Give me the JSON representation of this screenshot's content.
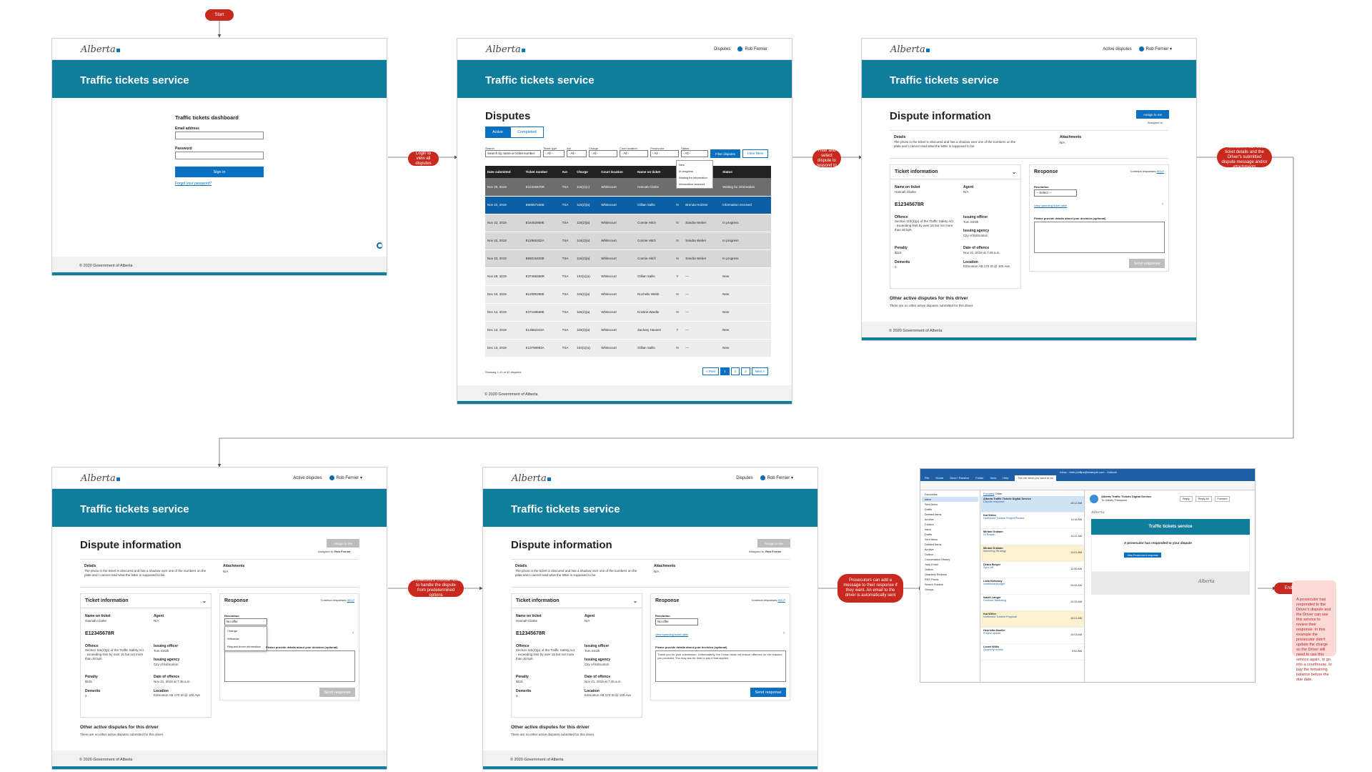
{
  "flow": {
    "start_label": "Start",
    "end_label": "End",
    "end_note": "A prosecutor has responded to the Driver's dispute and the Driver can use this service to review their response. In this example the prosecutor didn't update the charge so the Driver will need to use this service again, or go into a courthouse, to pay the remaining balance before the due date.",
    "step_labels": [
      "Login to view all disputes",
      "Filter and select dispute to respond to",
      "Prosecutors can view ticket details and the Driver's submitted dispute message and/or attachments",
      "Prosecutors choose how to handle the dispute from predetermined options",
      "Prosecutors can add a message to their response if they want. An email to the driver is automatically sent"
    ]
  },
  "brand": {
    "logo": "Alberta",
    "service_name": "Traffic tickets service",
    "footer": "© 2020 Government of Alberta",
    "user": "Rob Fernier",
    "nav_disputes": "Disputes",
    "nav_active_disputes": "Active disputes"
  },
  "login": {
    "title": "Traffic tickets dashboard",
    "email_label": "Email address",
    "password_label": "Password",
    "sign_in": "Sign in",
    "forgot": "Forgot your password?"
  },
  "disputes": {
    "title": "Disputes",
    "tab_active": "Active",
    "tab_completed": "Completed",
    "filter_labels": [
      "Search",
      "Ticket type",
      "Act",
      "Charge",
      "Court location",
      "Prosecutor",
      "Status"
    ],
    "search_placeholder": "Search by name or ticket number",
    "all_option": "- All -",
    "filter_button": "Filter disputes",
    "clear_button": "Clear filters",
    "status_options": [
      "New",
      "In progress",
      "Waiting for information",
      "Information received"
    ],
    "columns": [
      "Date submitted",
      "Ticket number",
      "Act",
      "Charge",
      "Court location",
      "Name on ticket",
      "Prosecutor",
      "Status"
    ],
    "rows": [
      [
        "Nov 20, 2019",
        "E12345678R",
        "TSA",
        "115(2)(c)",
        "Whitecourt",
        "Hannah Clarke",
        "N",
        "Waiting for information"
      ],
      [
        "Nov 22, 2019",
        "B90657165E",
        "TSA",
        "115(2)(a)",
        "Whitecourt",
        "Gillian Sallis",
        "N",
        "Information received"
      ],
      [
        "Nov 22, 2019",
        "E16452959E",
        "TSA",
        "115(2)(a)",
        "Whitecourt",
        "Connie Hitch",
        "N",
        "In progress"
      ],
      [
        "Nov 22, 2019",
        "E12565332A",
        "TSA",
        "115(2)(a)",
        "Whitecourt",
        "Connie Hitch",
        "N",
        "In progress"
      ],
      [
        "Nov 22, 2019",
        "B56015403E",
        "TSA",
        "115(2)(a)",
        "Whitecourt",
        "Connie Hitch",
        "N",
        "In progress"
      ],
      [
        "Nov 29, 2019",
        "E37468368R",
        "TSA",
        "104(1)(a)",
        "Whitecourt",
        "Gillian Sallis",
        "Y",
        "New"
      ],
      [
        "Dec 10, 2019",
        "B12095398E",
        "TSA",
        "115(2)(a)",
        "Whitecourt",
        "Rochelle Webb",
        "N",
        "New"
      ],
      [
        "Dec 12, 2019",
        "E37168568E",
        "TSA",
        "115(2)(a)",
        "Whitecourt",
        "Kristine Wardle",
        "N",
        "New"
      ],
      [
        "Dec 12, 2019",
        "E13562343A",
        "TSA",
        "115(2)(a)",
        "Whitecourt",
        "Zachary Hansen",
        "Y",
        "New"
      ],
      [
        "Dec 13, 2019",
        "E13790963A",
        "TSA",
        "104(1)(a)",
        "Whitecourt",
        "Gillian Sallis",
        "N",
        "New"
      ]
    ],
    "prosecutors": [
      "",
      "Brenda Holzner",
      "Sandra Weber",
      "Sandra Weber",
      "Sandra Weber",
      "—",
      "—",
      "—",
      "—",
      "—"
    ],
    "showing": "Showing 1-10 of 32 disputes",
    "pages": [
      "< Prev",
      "1",
      "2",
      "3",
      "Next >"
    ]
  },
  "dispute": {
    "title": "Dispute information",
    "assign_button": "Assign to me",
    "assigned_to_label": "Assigned to",
    "details_label": "Details",
    "details_text": "The photo in the ticket is obscured and has a shadow over one of the numbers on the plate and I cannot read what the letter is supposed to be.",
    "attachments_label": "Attachments",
    "attachments_value": "N/A",
    "ticket_info_label": "Ticket information",
    "name_label": "Name on ticket",
    "name_value": "Hannah Clarke",
    "agent_label": "Agent",
    "agent_value": "N/A",
    "ticket_number": "E12345678R",
    "offence_label": "Offence",
    "offence_value": "Section 115(2)(p) of the Traffic Safety Act - exceeding limit by over 15 but not more than 30 kph.",
    "officer_label": "Issuing officer",
    "officer_value": "Tom Smith",
    "agency_label": "Issuing agency",
    "agency_value": "City of Edmonton",
    "penalty_label": "Penalty",
    "penalty_value": "$115",
    "date_label": "Date of offence",
    "date_value": "Nov 21, 2019 at 7:45 a.m.",
    "demerits_label": "Demerits",
    "demerits_value": "2",
    "location_label": "Location",
    "location_value": "Edmonton AB 170 St @ 100 Ave",
    "response_label": "Response",
    "common_responses": "Common responses",
    "common_link": "HELP",
    "response_select_label": "Resolution",
    "select_placeholder": "-- Select --",
    "no_offer": "No offer",
    "options": [
      "Change",
      "Withdraw",
      "Request driver information"
    ],
    "view_ticket": "View speeding ticket table",
    "message_label": "Please provide details about your decision (optional)",
    "message_text": "Thank you for your submission. Unfortunately, the Crown does not reduce offences for the reasons you provided. You may ask for time to pay if that applies.",
    "send": "Send response",
    "other_title": "Other active disputes for this driver",
    "other_text": "There are no other active disputes submitted for this driver."
  },
  "outlook": {
    "window_title": "Inbox - beth.phillips@example.com - Outlook",
    "menu": [
      "File",
      "Home",
      "Send / Receive",
      "Folder",
      "View",
      "Help"
    ],
    "search": "Tell me what you want to do",
    "tabs": [
      "Focused",
      "Other"
    ],
    "folders": [
      "Favourites",
      "Inbox",
      "Sent Items",
      "Drafts",
      "Deleted Items",
      "Archive",
      "Folders",
      "Inbox",
      "Drafts",
      "Sent Items",
      "Deleted Items",
      "Archive",
      "Outbox",
      "Conversation History",
      "Junk Email",
      "Outbox",
      "Quarterly Reviews",
      "RSS Feeds",
      "Search Folders",
      "Groups"
    ],
    "messages": [
      {
        "from": "Alberta Traffic Tickets Digital Service",
        "subject": "Dispute response",
        "time": "10:12 AM"
      },
      {
        "from": "Kat Writer",
        "subject": "Northwind Traders Project Review",
        "time": "11:16 AM"
      },
      {
        "from": "Miriam Graham",
        "subject": "Hi Rowan",
        "time": "11:11 AM"
      },
      {
        "from": "Miriam Graham",
        "subject": "Marketing Strategy",
        "time": "11:01 AM"
      },
      {
        "from": "Debra Berger",
        "subject": "Sync-off",
        "time": "11:00 AM"
      },
      {
        "from": "Lidia Holloway",
        "subject": "Northwind Budget",
        "time": "10:43 AM"
      },
      {
        "from": "Isaiah Langer",
        "subject": "Contoso Marketing",
        "time": "10:33 AM"
      },
      {
        "from": "Kat Writer",
        "subject": "Northwind Traders Proposal",
        "time": "10:21 AM"
      },
      {
        "from": "Henrietta Mueller",
        "subject": "Project update",
        "time": "10:03 AM"
      },
      {
        "from": "Lionel Willis",
        "subject": "Quarterly review",
        "time": "9:52 AM"
      }
    ],
    "reading_from": "Alberta Traffic Tickets Digital Service",
    "reading_to": "To: Ashley Thompson",
    "email_heading": "A prosecutor has responded to your dispute",
    "email_button": "View Prosecutor's response",
    "actions": [
      "Reply",
      "Reply All",
      "Forward"
    ]
  }
}
